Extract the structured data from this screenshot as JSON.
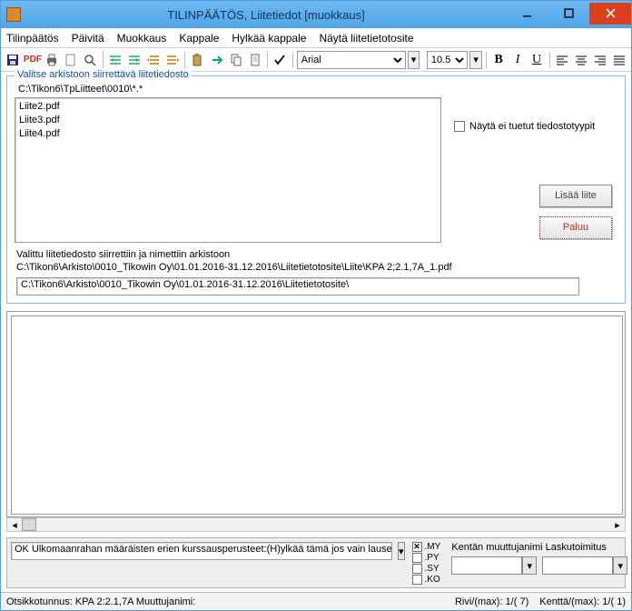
{
  "window": {
    "title": "TILINPÄÄTÖS, Liitetiedot [muokkaus]"
  },
  "menu": {
    "items": [
      "Tilinpäätös",
      "Päivitä",
      "Muokkaus",
      "Kappale",
      "Hylkää kappale",
      "Näytä liitetietotosite"
    ]
  },
  "toolbar": {
    "pdf_label": "PDF",
    "font": "Arial",
    "size": "10.5"
  },
  "fieldset": {
    "legend": "Valitse arkistoon siirrettävä liitetiedosto",
    "path": "C:\\Tikon6\\TpLiitteet\\0010\\*.*",
    "files": [
      "Liite2.pdf",
      "Liite3.pdf",
      "Liite4.pdf"
    ],
    "show_unsupported": "Näytä ei tuetut tiedostotyypit",
    "add_button": "Lisää liite",
    "return_button": "Paluu",
    "status_line1": "Valittu liitetiedosto siirrettiin ja nimettiin arkistoon",
    "status_line2": "C:\\Tikon6\\Arkisto\\0010_Tikowin Oy\\01.01.2016-31.12.2016\\Liitetietotosite\\Liite\\KPA 2;2.1,7A_1.pdf",
    "archive_path": "C:\\Tikon6\\Arkisto\\0010_Tikowin Oy\\01.01.2016-31.12.2016\\Liitetietotosite\\"
  },
  "bottom": {
    "prompt": "OK Ulkomaanrahan määräisten erien kurssausperusteet:(H)ylkää tämä jos vain lauseke",
    "ext": {
      "my": ".MY",
      "py": ".PY",
      "sy": ".SY",
      "ko": ".KO"
    },
    "right_label": "Kentän muuttujanimi Laskutoimitus"
  },
  "statusbar": {
    "left": "Otsikkotunnus: KPA 2:2.1,7A Muuttujanimi:",
    "rivi": "Rivi/(max): 1/( 7)",
    "kentta": "Kenttä/(max): 1/( 1)"
  }
}
